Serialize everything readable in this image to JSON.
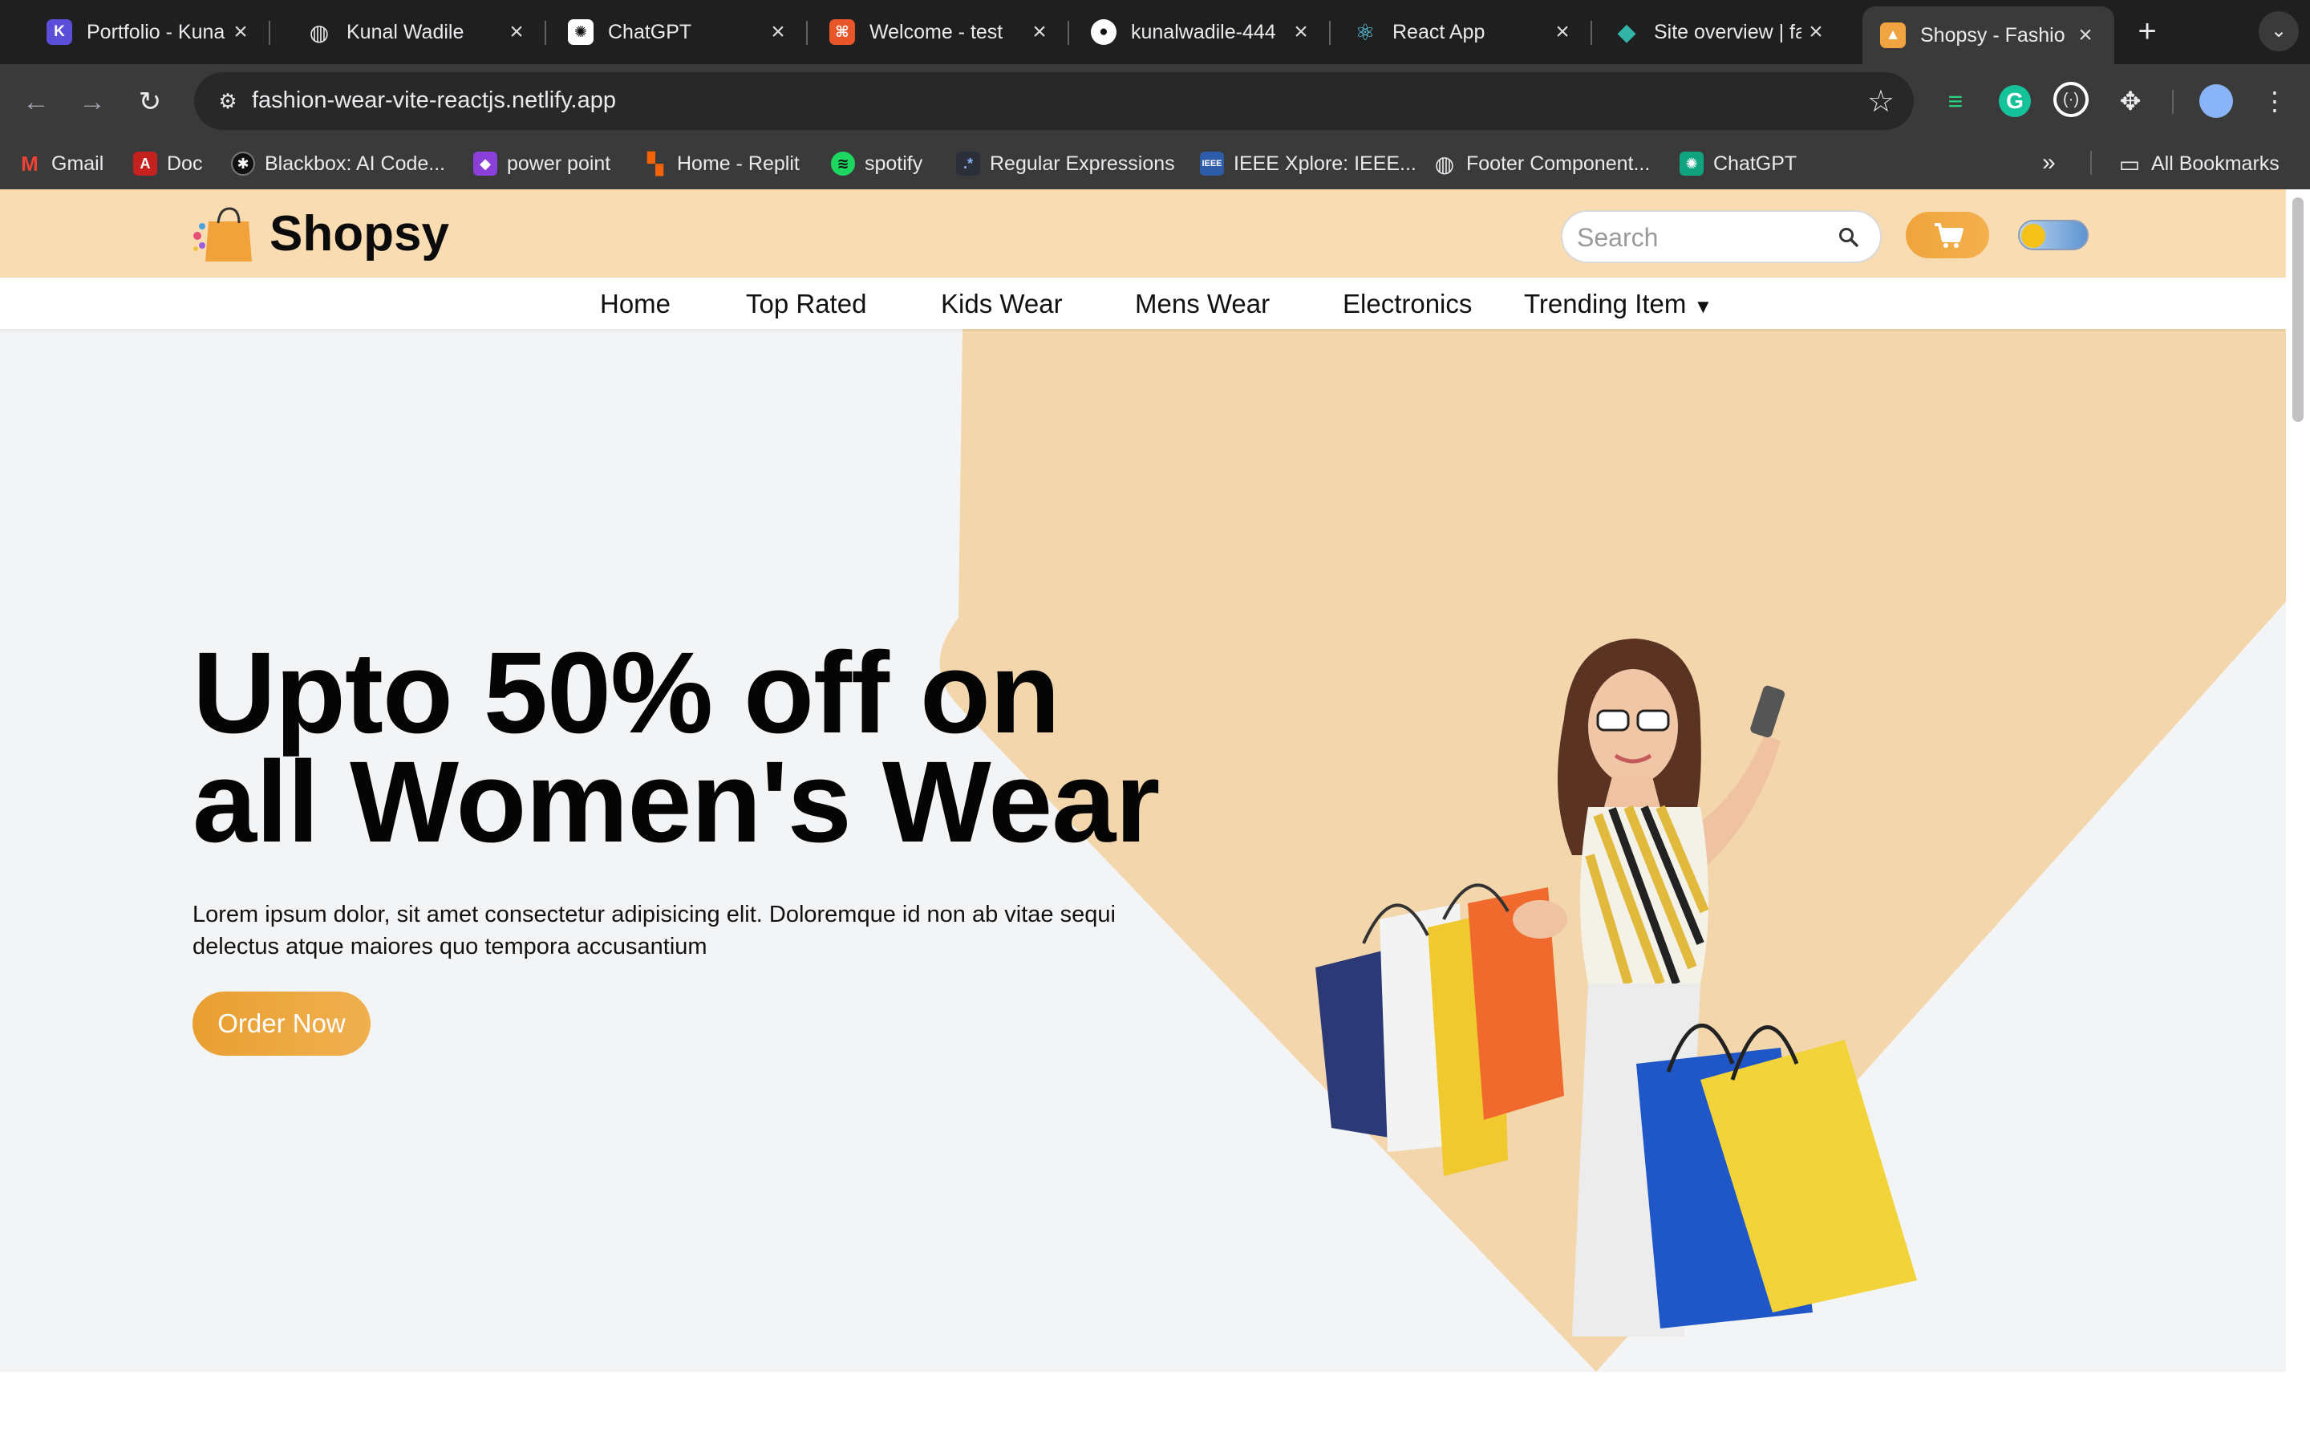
{
  "browser": {
    "tabs": [
      {
        "title": "Portfolio - Kunal",
        "icon": "portfolio-k-icon"
      },
      {
        "title": "Kunal Wadile",
        "icon": "globe-icon"
      },
      {
        "title": "ChatGPT",
        "icon": "chatgpt-icon"
      },
      {
        "title": "Welcome - test",
        "icon": "codeigniter-icon"
      },
      {
        "title": "kunalwadile-444",
        "icon": "github-icon"
      },
      {
        "title": "React App",
        "icon": "react-icon"
      },
      {
        "title": "Site overview | fa",
        "icon": "netlify-icon"
      },
      {
        "title": "Shopsy - Fashio",
        "icon": "shopsy-icon",
        "active": true
      }
    ],
    "url": "fashion-wear-vite-reactjs.netlify.app",
    "bookmarks": [
      {
        "label": "Gmail",
        "icon": "gmail-icon"
      },
      {
        "label": "Doc",
        "icon": "pdf-icon"
      },
      {
        "label": "Blackbox: AI Code...",
        "icon": "blackbox-icon"
      },
      {
        "label": "power point",
        "icon": "powerpoint-icon"
      },
      {
        "label": "Home - Replit",
        "icon": "replit-icon"
      },
      {
        "label": "spotify",
        "icon": "spotify-icon"
      },
      {
        "label": "Regular Expressions",
        "icon": "regex-icon"
      },
      {
        "label": "IEEE Xplore: IEEE...",
        "icon": "ieee-icon"
      },
      {
        "label": "Footer Component...",
        "icon": "globe-icon"
      },
      {
        "label": "ChatGPT",
        "icon": "chatgpt-icon"
      }
    ],
    "all_bookmarks": "All Bookmarks"
  },
  "site": {
    "brand": "Shopsy",
    "search_placeholder": "Search",
    "menu": [
      "Home",
      "Top Rated",
      "Kids Wear",
      "Mens Wear",
      "Electronics",
      "Trending Item"
    ],
    "hero": {
      "title_line1": "Upto 50% off on",
      "title_line2": "all Women's Wear",
      "description": "Lorem ipsum dolor, sit amet consectetur adipisicing elit. Doloremque id non ab vitae sequi delectus atque maiores quo tempora accusantium",
      "cta": "Order Now"
    },
    "colors": {
      "header_bg": "#f9dcb1",
      "accent": "#efa43c",
      "hero_shape": "#f3d6ac"
    },
    "theme_toggle": "dark-mode-toggle"
  }
}
